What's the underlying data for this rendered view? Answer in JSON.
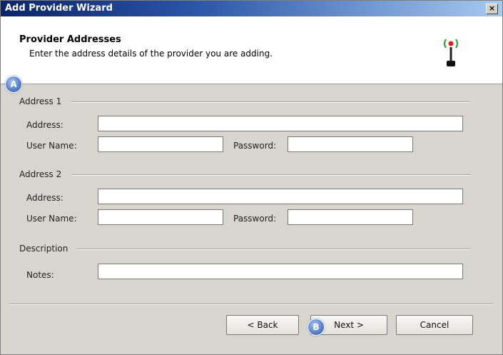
{
  "window": {
    "title": "Add Provider Wizard",
    "close_glyph": "×"
  },
  "header": {
    "title": "Provider Addresses",
    "subtitle": "Enter the address details of the provider you are adding.",
    "icon": "radio-tower-icon"
  },
  "annotations": {
    "a": "A",
    "b": "B"
  },
  "address1": {
    "group": "Address 1",
    "address_label": "Address:",
    "address_value": "",
    "username_label": "User Name:",
    "username_value": "",
    "password_label": "Password:",
    "password_value": ""
  },
  "address2": {
    "group": "Address 2",
    "address_label": "Address:",
    "address_value": "",
    "username_label": "User Name:",
    "username_value": "",
    "password_label": "Password:",
    "password_value": ""
  },
  "description": {
    "group": "Description",
    "notes_label": "Notes:",
    "notes_value": ""
  },
  "buttons": {
    "back": "< Back",
    "next": "Next >",
    "cancel": "Cancel"
  },
  "colors": {
    "title_bar": "#0a246a",
    "accent_red": "#e02020",
    "accent_green": "#2aa02a"
  }
}
